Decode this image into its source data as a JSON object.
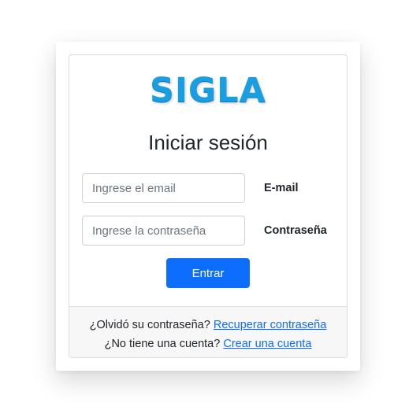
{
  "logo": {
    "text": "SIGLA",
    "color": "#1a9ee2"
  },
  "title": "Iniciar sesión",
  "form": {
    "email": {
      "placeholder": "Ingrese el email",
      "value": "",
      "label": "E-mail"
    },
    "password": {
      "placeholder": "Ingrese la contraseña",
      "value": "",
      "label": "Contraseña"
    },
    "submit_label": "Entrar"
  },
  "footer": {
    "forgot_text": "¿Olvidó su contraseña?",
    "forgot_link": "Recuperar contraseña",
    "signup_text": "¿No tiene una cuenta?",
    "signup_link": "Crear una cuenta"
  },
  "colors": {
    "primary": "#0d6efd",
    "footer_bg": "#f7f7f7",
    "border": "#dcdcdc"
  }
}
